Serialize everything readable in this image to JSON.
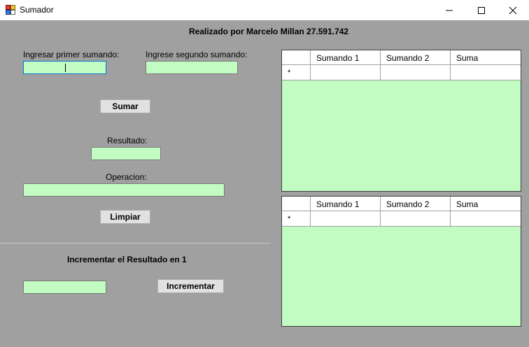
{
  "window": {
    "title": "Sumador"
  },
  "header": {
    "author_text": "Realizado por Marcelo Millan 27.591.742"
  },
  "form": {
    "first_label": "Ingresar primer sumando:",
    "second_label": "Ingrese segundo sumando:",
    "first_value": "",
    "second_value": "",
    "sumar_label": "Sumar",
    "resultado_label": "Resultado:",
    "resultado_value": "",
    "operacion_label": "Operacion:",
    "operacion_value": "",
    "limpiar_label": "Limpiar"
  },
  "increment": {
    "heading": "Incrementar el Resultado en 1",
    "value": "",
    "button_label": "Incrementar"
  },
  "grid_top": {
    "columns": [
      "Sumando 1",
      "Sumando 2",
      "Suma"
    ],
    "new_row_marker": "*"
  },
  "grid_bottom": {
    "columns": [
      "Sumando 1",
      "Sumando 2",
      "Suma"
    ],
    "new_row_marker": "*"
  },
  "colors": {
    "background": "#a0a0a0",
    "input_fill": "#c2fcc2",
    "focus_border": "#0078d7"
  },
  "icons": [
    "app-icon",
    "minimize-icon",
    "maximize-icon",
    "close-icon"
  ]
}
